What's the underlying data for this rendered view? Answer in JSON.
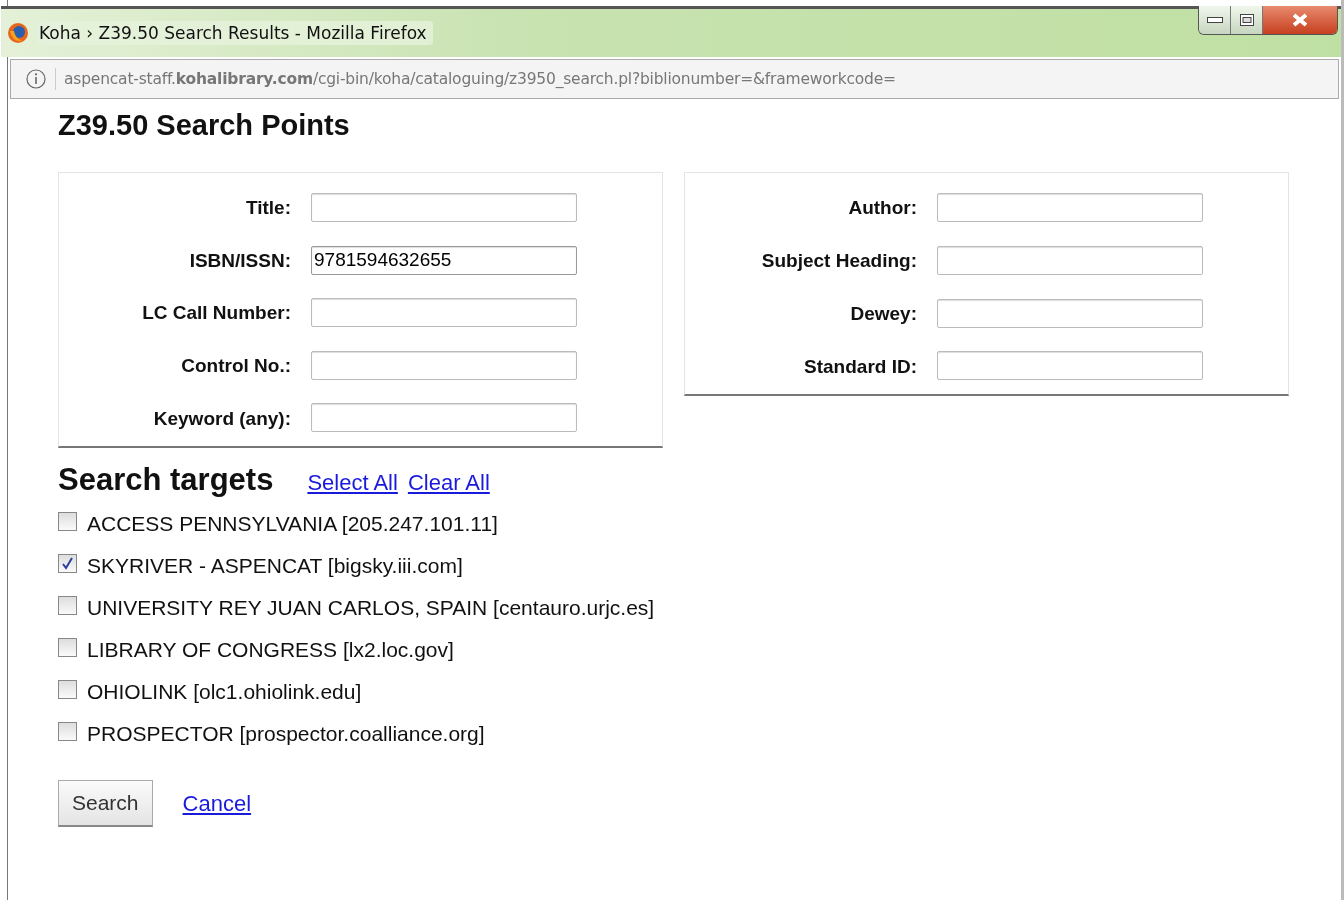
{
  "window": {
    "title": "Koha › Z39.50 Search Results - Mozilla Firefox"
  },
  "address_bar": {
    "url": "aspencat-staff.**kohalibrary.com**/cgi-bin/koha/cataloguing/z3950_search.pl?biblionumber=&frameworkcode="
  },
  "heading": "Z39.50 Search Points",
  "left_fields": [
    {
      "label": "Title:"
    },
    {
      "label": "ISBN/ISSN:",
      "value": "9781594632655",
      "focused": true
    },
    {
      "label": "LC Call Number:"
    },
    {
      "label": "Control No.:"
    },
    {
      "label": "Keyword (any):"
    }
  ],
  "right_fields": [
    {
      "label": "Author:"
    },
    {
      "label": "Subject Heading:"
    },
    {
      "label": "Dewey:"
    },
    {
      "label": "Standard ID:"
    }
  ],
  "targets": {
    "title": "Search targets",
    "links": [
      "Select All",
      "Clear All"
    ],
    "items": [
      {
        "label": "ACCESS PENNSYLVANIA [205.247.101.11]",
        "checked": false
      },
      {
        "label": "SKYRIVER - ASPENCAT [bigsky.iii.com]",
        "checked": true
      },
      {
        "label": "UNIVERSITY REY JUAN CARLOS, SPAIN [centauro.urjc.es]",
        "checked": false
      },
      {
        "label": "LIBRARY OF CONGRESS [lx2.loc.gov]",
        "checked": false
      },
      {
        "label": "OHIOLINK [olc1.ohiolink.edu]",
        "checked": false
      },
      {
        "label": "PROSPECTOR [prospector.coalliance.org]",
        "checked": false
      }
    ]
  },
  "actions": {
    "button": "Search",
    "link": "Cancel"
  }
}
